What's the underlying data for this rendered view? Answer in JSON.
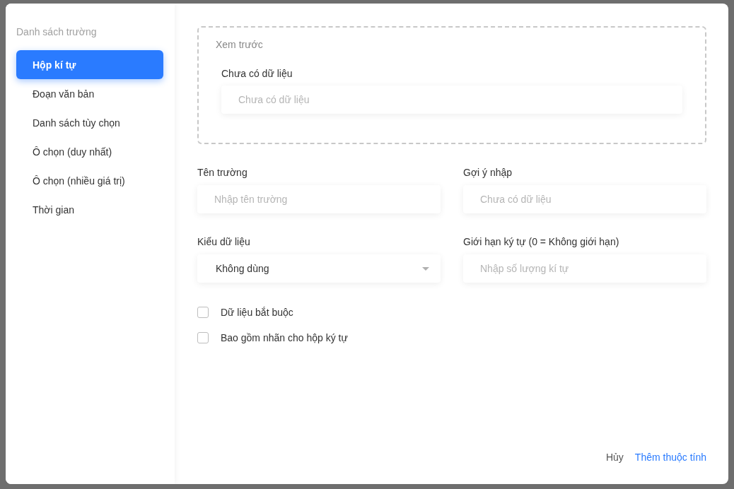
{
  "sidebar": {
    "title": "Danh sách trường",
    "items": [
      {
        "label": "Hộp kí tự",
        "selected": true
      },
      {
        "label": "Đoạn văn bản",
        "selected": false
      },
      {
        "label": "Danh sách tùy chọn",
        "selected": false
      },
      {
        "label": "Ô chọn (duy nhất)",
        "selected": false
      },
      {
        "label": "Ô chọn (nhiều giá trị)",
        "selected": false
      },
      {
        "label": "Thời gian",
        "selected": false
      }
    ]
  },
  "preview": {
    "title": "Xem trước",
    "field_label": "Chưa có dữ liệu",
    "placeholder": "Chưa có dữ liệu"
  },
  "fields": [
    {
      "kind": "input",
      "label": "Tên trường",
      "placeholder": "Nhập tên trường"
    },
    {
      "kind": "input",
      "label": "Gợi ý nhập",
      "placeholder": "Chưa có dữ liệu"
    },
    {
      "kind": "select",
      "label": "Kiểu dữ liệu",
      "value": "Không dùng"
    },
    {
      "kind": "input",
      "label": "Giới hạn ký tự (0 = Không giới hạn)",
      "placeholder": "Nhập số lượng kí tự"
    }
  ],
  "checkboxes": [
    {
      "label": "Dữ liệu bắt buộc",
      "checked": false
    },
    {
      "label": "Bao gồm nhãn cho hộp ký tự",
      "checked": false
    }
  ],
  "buttons": {
    "cancel": "Hủy",
    "submit": "Thêm thuộc tính"
  }
}
